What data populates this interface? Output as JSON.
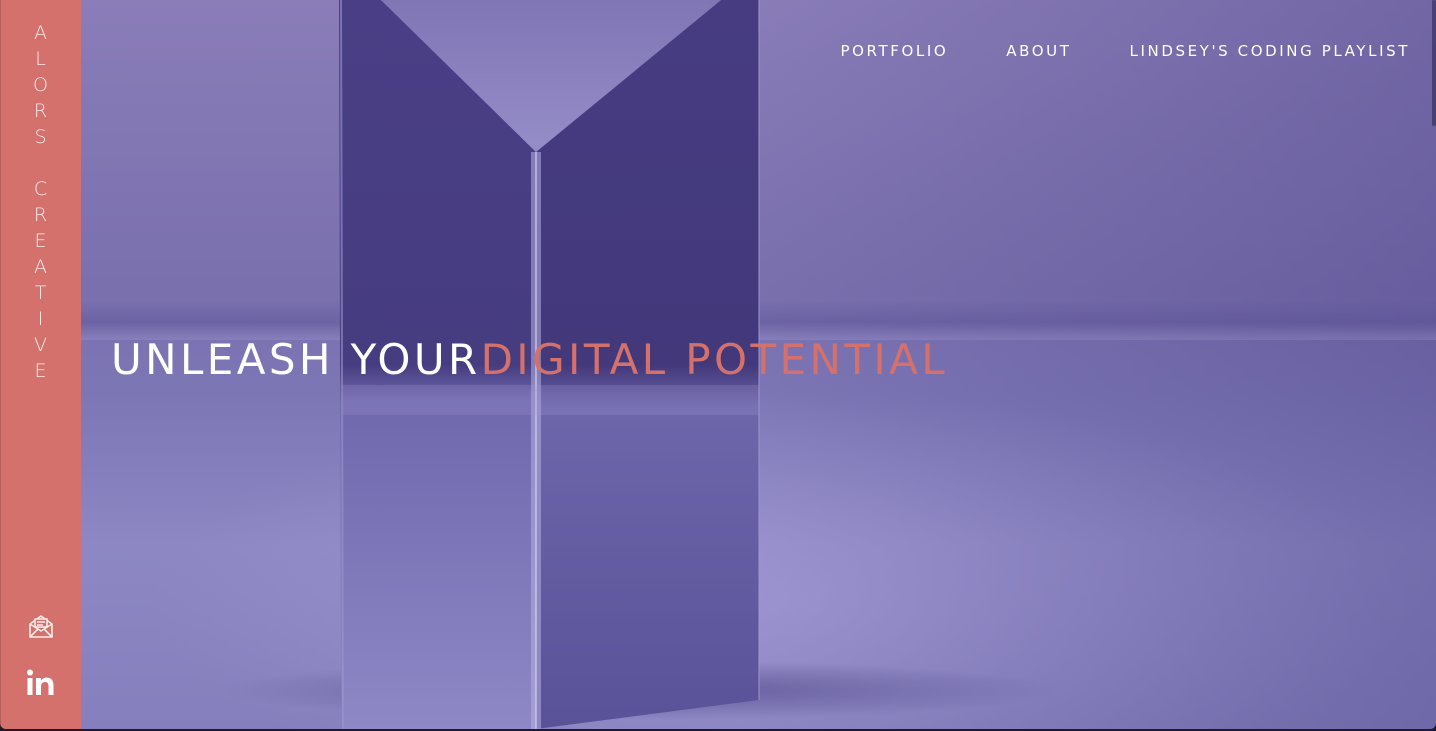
{
  "sidebar": {
    "brand_letters": [
      "A",
      "L",
      "O",
      "R",
      "S",
      "",
      "C",
      "R",
      "E",
      "A",
      "T",
      "I",
      "V",
      "E"
    ],
    "icons": {
      "mail": "mail-icon",
      "linkedin": "linkedin-icon"
    }
  },
  "nav": {
    "items": [
      {
        "label": "PORTFOLIO"
      },
      {
        "label": "ABOUT"
      },
      {
        "label": "LINDSEY'S CODING PLAYLIST"
      }
    ]
  },
  "hero": {
    "headline_white": "UNLEASH YOUR",
    "headline_accent": "DIGITAL POTENTIAL"
  },
  "colors": {
    "accent": "#d4716c",
    "hero_purple": "#7d77b6",
    "text_light": "#ffffff"
  }
}
